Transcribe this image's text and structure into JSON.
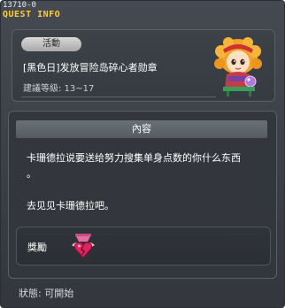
{
  "window": {
    "code": "13710-0",
    "title": "QUEST INFO"
  },
  "quest": {
    "category": "活動",
    "name": "[黑色日]发放冒险岛碎心者勋章",
    "level_range": "建議等級: 13~17",
    "npc_icon": "npc-portrait-icon"
  },
  "content": {
    "header": "內容",
    "description_line1": "卡珊德拉说要送给努力搜集单身点数的你什么东西",
    "description_line2": "。",
    "description_line3": "去见见卡珊德拉吧。"
  },
  "reward": {
    "label": "獎勵",
    "icon": "medal-heart-icon"
  },
  "status": {
    "text": "狀態: 可開始"
  },
  "colors": {
    "title": "#ffcc33",
    "background": "#3a3e45",
    "panel_border": "#5a5f68"
  }
}
